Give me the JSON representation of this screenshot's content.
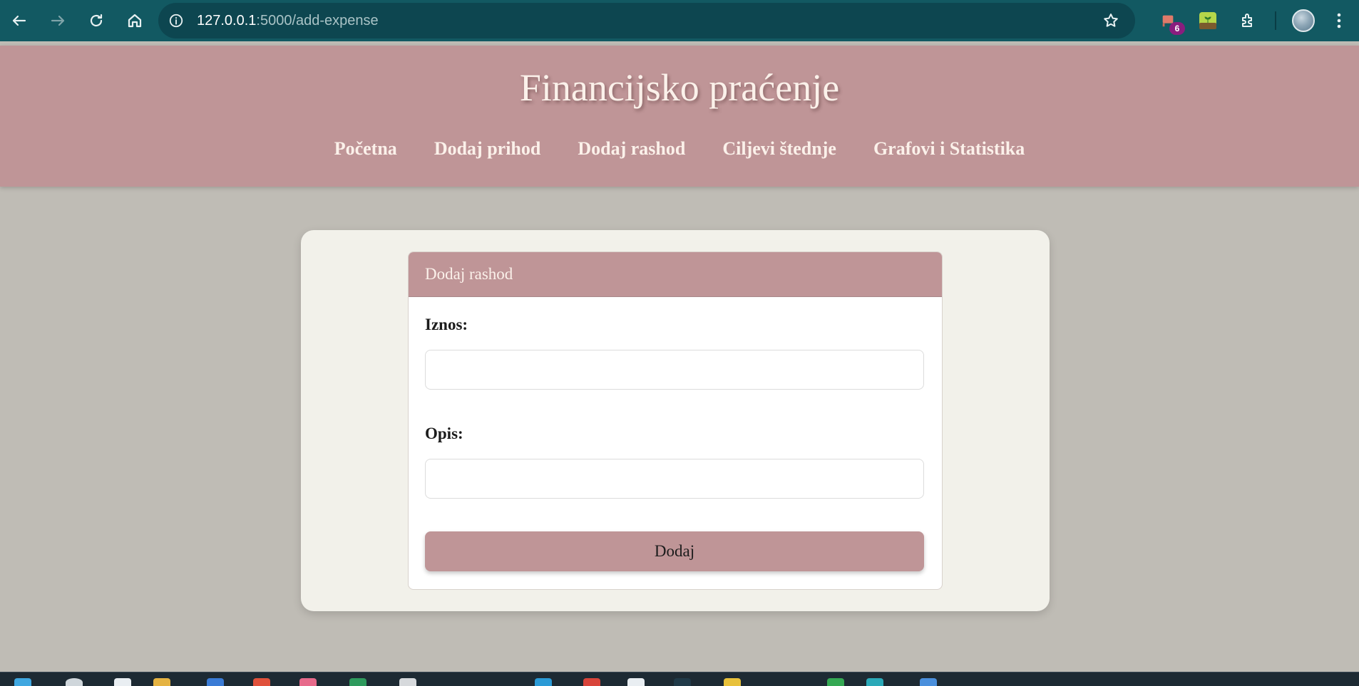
{
  "browser": {
    "url_host": "127.0.0.1",
    "url_path": ":5000/add-expense",
    "extension_badge": "6",
    "icons": [
      "back-icon",
      "forward-icon",
      "reload-icon",
      "home-icon",
      "site-info-icon",
      "star-icon",
      "extensions-icon",
      "menu-icon"
    ]
  },
  "site": {
    "title": "Financijsko praćenje",
    "nav": [
      {
        "label": "Početna"
      },
      {
        "label": "Dodaj prihod"
      },
      {
        "label": "Dodaj rashod"
      },
      {
        "label": "Ciljevi štednje"
      },
      {
        "label": "Grafovi i Statistika"
      }
    ]
  },
  "form": {
    "header": "Dodaj rashod",
    "amount_label": "Iznos:",
    "amount_value": "",
    "description_label": "Opis:",
    "description_value": "",
    "submit_label": "Dodaj"
  },
  "colors": {
    "chrome": "#125962",
    "header": "#bf9597",
    "page_bg": "#bfbcb5",
    "panel_bg": "#f2f1ea"
  }
}
